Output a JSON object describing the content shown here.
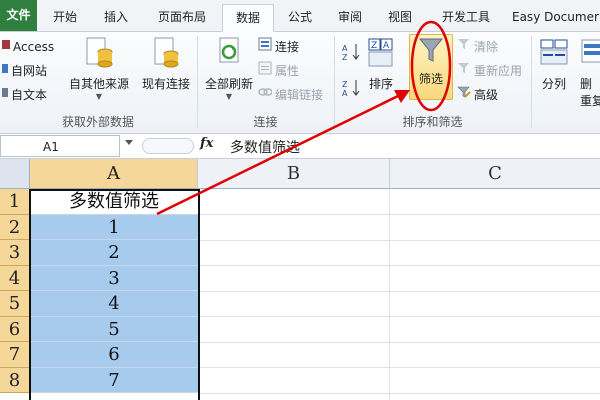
{
  "tabs": {
    "file": "文件",
    "home": "开始",
    "insert": "插入",
    "page_layout": "页面布局",
    "data": "数据",
    "formulas": "公式",
    "review": "审阅",
    "view": "视图",
    "developer": "开发工具",
    "easy_doc": "Easy Documer"
  },
  "ribbon": {
    "external": {
      "access": "Access",
      "web": "自网站",
      "text": "自文本",
      "other_sources": "自其他来源",
      "existing": "现有连接",
      "group_label": "获取外部数据"
    },
    "connections": {
      "refresh_all": "全部刷新",
      "connections": "连接",
      "properties": "属性",
      "edit_links": "编辑链接",
      "group_label": "连接"
    },
    "sort_filter": {
      "sort": "排序",
      "filter": "筛选",
      "clear": "清除",
      "reapply": "重新应用",
      "advanced": "高级",
      "group_label": "排序和筛选"
    },
    "tools": {
      "text_to_columns": "分列",
      "remove": "删",
      "duplicates": "重复"
    }
  },
  "formula_bar": {
    "name_box": "A1",
    "fx": "fx",
    "formula": "多数值筛选"
  },
  "grid": {
    "columns": [
      "A",
      "B",
      "C"
    ],
    "rows": [
      {
        "num": "1",
        "a": "多数值筛选"
      },
      {
        "num": "2",
        "a": "1"
      },
      {
        "num": "3",
        "a": "2"
      },
      {
        "num": "4",
        "a": "3"
      },
      {
        "num": "5",
        "a": "4"
      },
      {
        "num": "6",
        "a": "5"
      },
      {
        "num": "7",
        "a": "6"
      },
      {
        "num": "8",
        "a": "7"
      }
    ]
  },
  "colors": {
    "file_tab": "#2f7f3e",
    "selection_fill": "#a7cbed",
    "header_highlight": "#f5d79a",
    "annotation": "#e00000"
  }
}
